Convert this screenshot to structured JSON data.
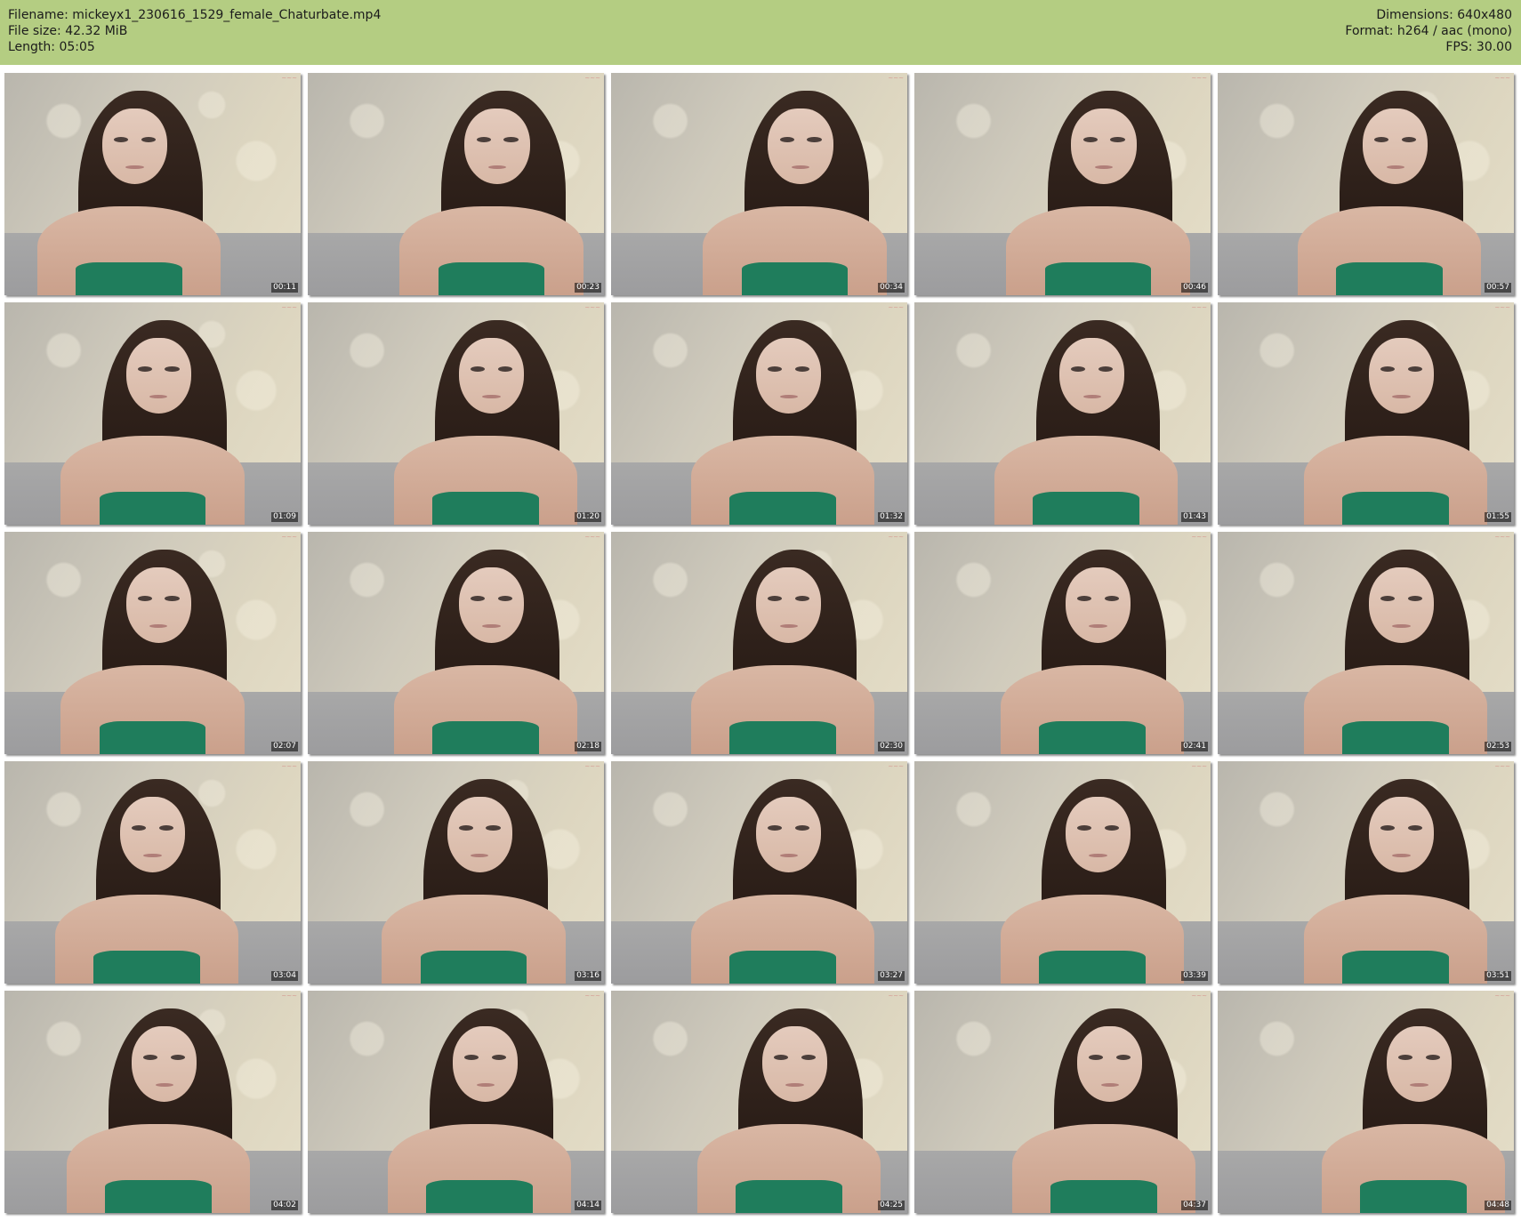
{
  "header": {
    "filename_line": "Filename: mickeyx1_230616_1529_female_Chaturbate.mp4",
    "filesize_line": "File size: 42.32 MiB",
    "length_line": "Length: 05:05",
    "dimensions_line": "Dimensions: 640x480",
    "format_line": "Format: h264 / aac (mono)",
    "fps_line": "FPS: 30.00",
    "bg_color": "#b4cd82"
  },
  "thumbnails": [
    {
      "time": "00:11"
    },
    {
      "time": "00:23"
    },
    {
      "time": "00:34"
    },
    {
      "time": "00:46"
    },
    {
      "time": "00:57"
    },
    {
      "time": "01:09"
    },
    {
      "time": "01:20"
    },
    {
      "time": "01:32"
    },
    {
      "time": "01:43"
    },
    {
      "time": "01:55"
    },
    {
      "time": "02:07"
    },
    {
      "time": "02:18"
    },
    {
      "time": "02:30"
    },
    {
      "time": "02:41"
    },
    {
      "time": "02:53"
    },
    {
      "time": "03:04"
    },
    {
      "time": "03:16"
    },
    {
      "time": "03:27"
    },
    {
      "time": "03:39"
    },
    {
      "time": "03:51"
    },
    {
      "time": "04:02"
    },
    {
      "time": "04:14"
    },
    {
      "time": "04:25"
    },
    {
      "time": "04:37"
    },
    {
      "time": "04:48"
    }
  ]
}
